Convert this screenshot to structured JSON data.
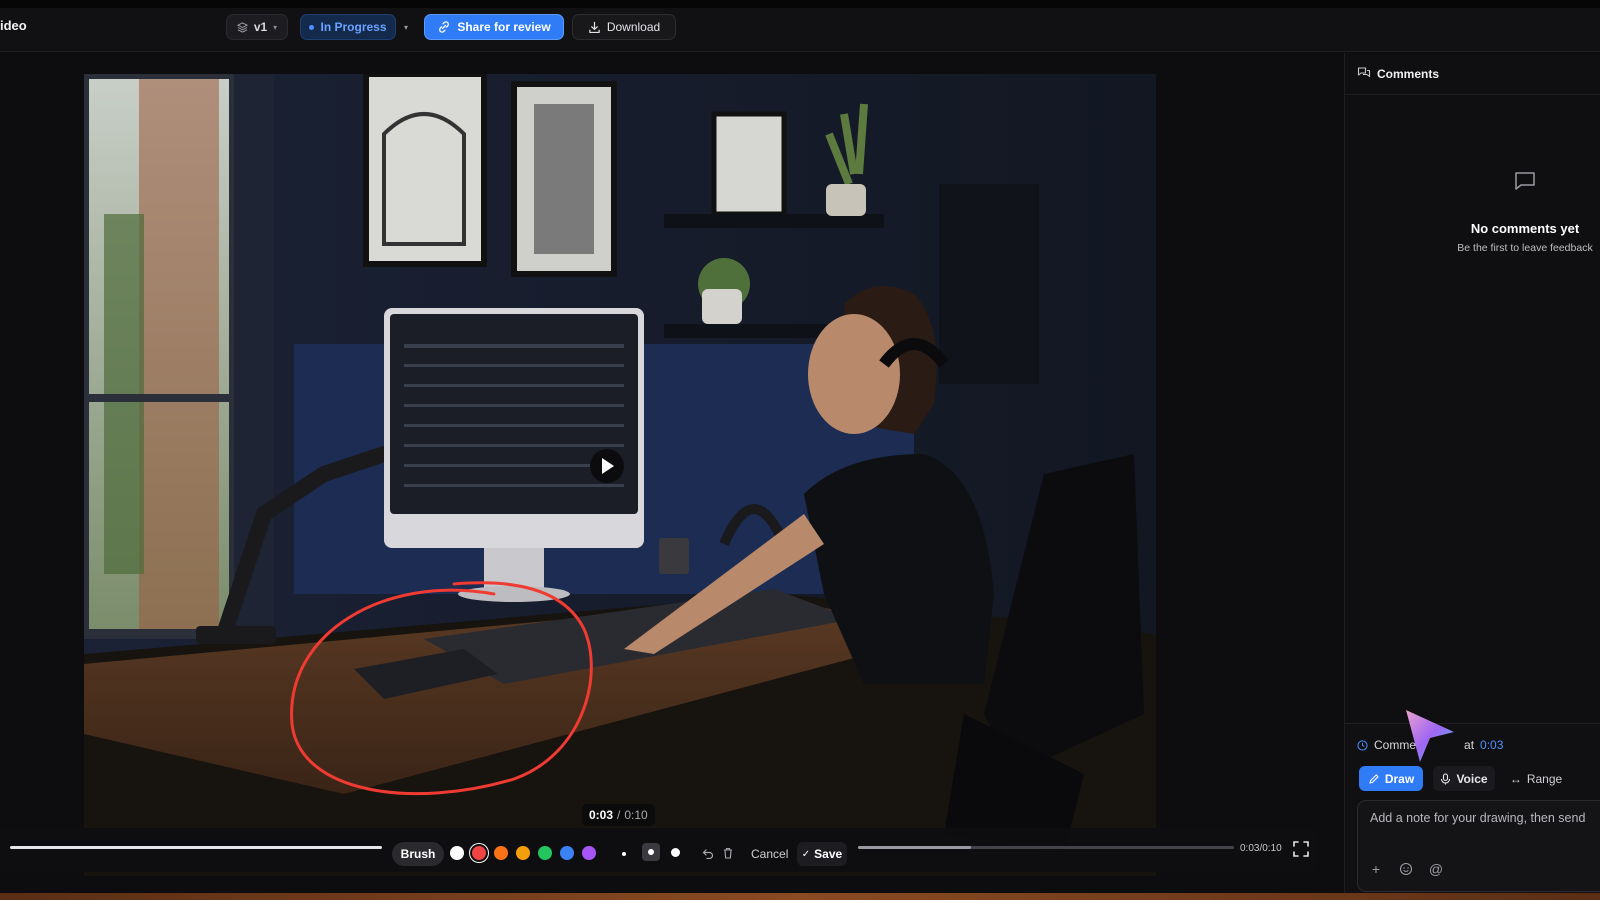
{
  "header": {
    "title": "ideo",
    "version": "v1",
    "status": "In Progress",
    "share_label": "Share for review",
    "download_label": "Download"
  },
  "player": {
    "current_time": "0:03",
    "separator": "/",
    "total_time": "0:10",
    "timecode_small": "0:03/0:10",
    "progress": 0.3,
    "brush_label": "Brush",
    "cancel_label": "Cancel",
    "save_label": "Save",
    "palette": [
      "#ffffff",
      "#ef4444",
      "#f97316",
      "#f59e0b",
      "#22c55e",
      "#3b82f6",
      "#a855f7"
    ],
    "selected_color": "#ef4444"
  },
  "sidebar": {
    "title": "Comments",
    "empty_title": "No comments yet",
    "empty_subtitle": "Be the first to leave feedback",
    "composer": {
      "prefix": "Comme",
      "at_label": "at",
      "timestamp": "0:03",
      "modes": {
        "draw": "Draw",
        "voice": "Voice",
        "range": "Range"
      },
      "placeholder": "Add a note for your drawing, then send"
    }
  },
  "colors": {
    "accent": "#2f7cf6",
    "annotation": "#ef3b32",
    "status_text": "#69a2ff"
  }
}
